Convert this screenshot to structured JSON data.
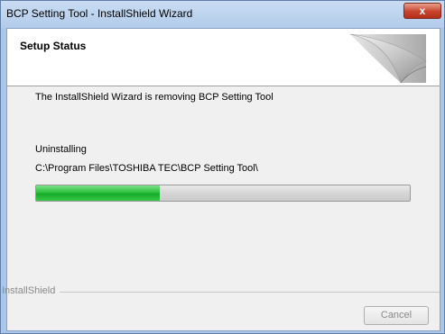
{
  "window": {
    "title": "BCP Setting Tool - InstallShield Wizard",
    "close_glyph": "x"
  },
  "header": {
    "title": "Setup Status",
    "graphic_icon": "page-curl-graphic"
  },
  "main": {
    "status_message": "The InstallShield Wizard is removing BCP Setting Tool",
    "action": "Uninstalling",
    "path": "C:\\Program Files\\TOSHIBA TEC\\BCP Setting Tool\\",
    "progress_percent": 33
  },
  "footer": {
    "brand": "InstallShield",
    "cancel_label": "Cancel",
    "cancel_enabled": false
  },
  "colors": {
    "progress_green": "#2ec340",
    "title_bar": "#b9d1ee",
    "close_red": "#c8432d"
  }
}
